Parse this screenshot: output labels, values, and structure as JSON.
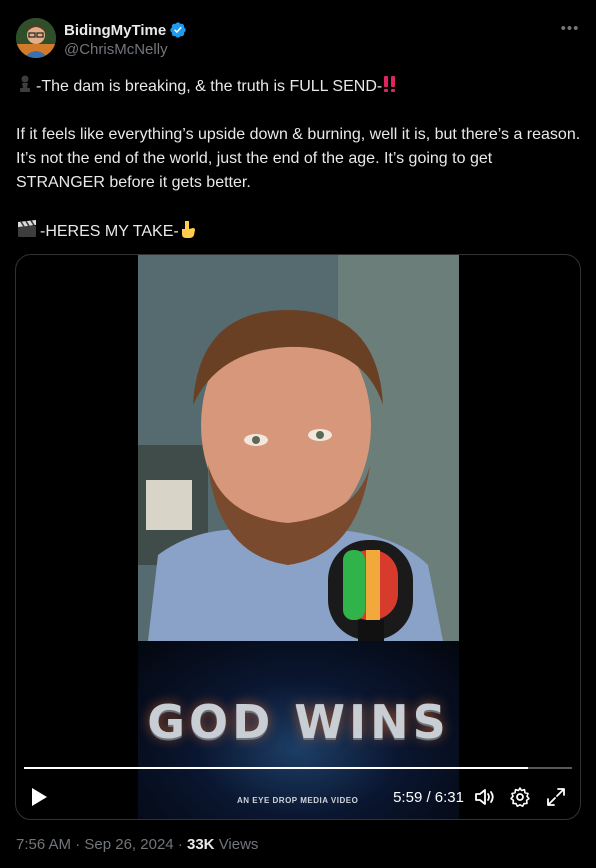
{
  "author": {
    "display_name": "BidingMyTime",
    "handle": "@ChrisMcNelly",
    "verified": true,
    "avatar_icon": "avatar-icon"
  },
  "more_icon": "more-icon",
  "tweet": {
    "line1": "-The dam is breaking, & the truth is FULL SEND-",
    "line1_lead_emoji": "chess-pawn-icon",
    "line1_trail_emoji": "double-exclamation-icon",
    "paragraph2": "If it feels like everything’s upside down & burning, well it is, but there’s a reason. It’s not the end of the world, just the end of the age. It’s going to get STRANGER before it gets better.",
    "line3": "-HERES MY TAKE-",
    "line3_lead_emoji": "clapper-board-icon",
    "line3_trail_emoji": "pointing-down-icon"
  },
  "video": {
    "overlay_title": "GOD WINS",
    "credit": "AN EYE DROP MEDIA VIDEO",
    "current_time": "5:59",
    "duration": "6:31",
    "time_display": "5:59 / 6:31",
    "progress_fraction": 0.92
  },
  "footer": {
    "time": "7:56 AM",
    "date": "Sep 26, 2024",
    "views_count": "33K",
    "views_label": "Views",
    "separator": "·"
  },
  "colors": {
    "background": "#000000",
    "text_primary": "#e7e9ea",
    "text_secondary": "#71767b",
    "verified_blue": "#1d9bf0",
    "border": "#2f3336"
  }
}
